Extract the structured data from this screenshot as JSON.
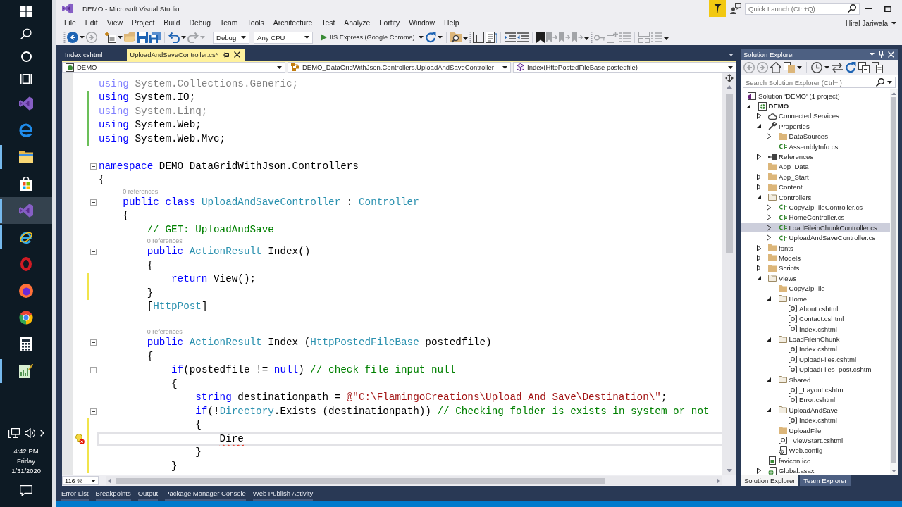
{
  "taskbar": {
    "apps": [
      {
        "running": false,
        "selected": false
      },
      {
        "running": false,
        "selected": false
      },
      {
        "running": true,
        "selected": false
      },
      {
        "running": false,
        "selected": false
      },
      {
        "running": true,
        "selected": true
      },
      {
        "running": true,
        "selected": false
      },
      {
        "running": false,
        "selected": false
      },
      {
        "running": false,
        "selected": false
      },
      {
        "running": false,
        "selected": false
      },
      {
        "running": false,
        "selected": false
      },
      {
        "running": true,
        "selected": false
      }
    ],
    "clock": {
      "time": "4:42 PM",
      "day": "Friday",
      "date": "1/31/2020"
    }
  },
  "window": {
    "title": "DEMO - Microsoft Visual Studio",
    "quick_launch": {
      "placeholder": "Quick Launch (Ctrl+Q)"
    },
    "account": "Hiral Jariwala"
  },
  "menu": [
    "File",
    "Edit",
    "View",
    "Project",
    "Build",
    "Debug",
    "Team",
    "Tools",
    "Architecture",
    "Test",
    "Analyze",
    "Fortify",
    "Window",
    "Help"
  ],
  "toolbar": {
    "left_buttons": [
      {
        "disabled": false
      },
      {
        "disabled": true
      },
      {
        "disabled": false
      },
      {
        "disabled": false
      },
      {
        "disabled": false
      },
      {
        "disabled": false
      },
      {
        "disabled": false
      },
      {
        "disabled": true
      }
    ],
    "configuration": "Debug",
    "platform": "Any CPU",
    "run_target": "IIS Express (Google Chrome)",
    "right_buttons": [
      {
        "disabled": false
      },
      {
        "disabled": false
      },
      {
        "disabled": false
      },
      {
        "disabled": false
      },
      {
        "disabled": false
      },
      {
        "disabled": false
      },
      {
        "disabled": false
      },
      {
        "disabled": true
      },
      {
        "disabled": true
      },
      {
        "disabled": true
      },
      {
        "disabled": true
      },
      {
        "disabled": true
      },
      {
        "disabled": true
      },
      {
        "disabled": true
      },
      {
        "disabled": true
      }
    ]
  },
  "document_tabs": [
    {
      "label": "Index.cshtml",
      "selected": false
    },
    {
      "label": "UploadAndSaveController.cs*",
      "selected": true
    }
  ],
  "navigation_bar": {
    "project": "DEMO",
    "type": "DEMO_DataGridWithJson.Controllers.UploadAndSaveController",
    "member": "Index(HttpPostedFileBase postedfile)"
  },
  "editor": {
    "lines": [
      {
        "faded": true,
        "current": false,
        "fold": false,
        "modified": false,
        "tokens": [
          {
            "text": "using",
            "kind": "keyword"
          },
          {
            "text": " System.Collections.Generic;",
            "kind": "plain"
          }
        ]
      },
      {
        "faded": false,
        "current": false,
        "fold": false,
        "modified": true,
        "saved": true,
        "tokens": [
          {
            "text": "using",
            "kind": "keyword"
          },
          {
            "text": " System.IO;",
            "kind": "plain"
          }
        ]
      },
      {
        "faded": true,
        "current": false,
        "fold": false,
        "modified": true,
        "saved": true,
        "tokens": [
          {
            "text": "using",
            "kind": "keyword"
          },
          {
            "text": " System.Linq;",
            "kind": "plain"
          }
        ]
      },
      {
        "faded": false,
        "current": false,
        "fold": false,
        "modified": true,
        "saved": true,
        "tokens": [
          {
            "text": "using",
            "kind": "keyword"
          },
          {
            "text": " System.Web;",
            "kind": "plain"
          }
        ]
      },
      {
        "faded": false,
        "current": false,
        "fold": false,
        "modified": true,
        "saved": true,
        "tokens": [
          {
            "text": "using",
            "kind": "keyword"
          },
          {
            "text": " System.Web.Mvc;",
            "kind": "plain"
          }
        ]
      },
      {
        "current": false,
        "fold": false,
        "modified": false
      },
      {
        "faded": false,
        "current": false,
        "fold": true,
        "modified": false,
        "tokens": [
          {
            "text": "namespace",
            "kind": "keyword"
          },
          {
            "text": " DEMO_DataGridWithJson.Controllers",
            "kind": "plain"
          }
        ]
      },
      {
        "faded": false,
        "current": false,
        "fold": false,
        "modified": false,
        "tokens": [
          {
            "text": "{",
            "kind": "plain"
          }
        ]
      },
      {
        "lens": "0 references",
        "faded": false,
        "current": false,
        "fold": true,
        "modified": false,
        "tokens": [
          {
            "text": "    public class",
            "kind": "keyword"
          },
          {
            "text": " UploadAndSaveController",
            "kind": "type"
          },
          {
            "text": " : ",
            "kind": "plain"
          },
          {
            "text": "Controller",
            "kind": "type"
          }
        ]
      },
      {
        "faded": false,
        "current": false,
        "fold": false,
        "modified": false,
        "tokens": [
          {
            "text": "    {",
            "kind": "plain"
          }
        ]
      },
      {
        "faded": false,
        "current": false,
        "fold": false,
        "modified": false,
        "tokens": [
          {
            "text": "        // GET: UploadAndSave",
            "kind": "comment"
          }
        ]
      },
      {
        "lens": "0 references",
        "faded": false,
        "current": false,
        "fold": true,
        "modified": false,
        "tokens": [
          {
            "text": "        public",
            "kind": "keyword"
          },
          {
            "text": " ActionResult",
            "kind": "type"
          },
          {
            "text": " Index()",
            "kind": "plain"
          }
        ]
      },
      {
        "faded": false,
        "current": false,
        "fold": false,
        "modified": false,
        "tokens": [
          {
            "text": "        {",
            "kind": "plain"
          }
        ]
      },
      {
        "faded": false,
        "current": false,
        "fold": false,
        "modified": true,
        "saved": false,
        "tokens": [
          {
            "text": "            return",
            "kind": "keyword"
          },
          {
            "text": " View();",
            "kind": "plain"
          }
        ]
      },
      {
        "faded": false,
        "current": false,
        "fold": false,
        "modified": true,
        "saved": false,
        "tokens": [
          {
            "text": "        }",
            "kind": "plain"
          }
        ]
      },
      {
        "faded": false,
        "current": false,
        "fold": false,
        "modified": false,
        "tokens": [
          {
            "text": "        [",
            "kind": "plain"
          },
          {
            "text": "HttpPost",
            "kind": "type"
          },
          {
            "text": "]",
            "kind": "plain"
          }
        ]
      },
      {
        "current": false,
        "fold": false,
        "modified": false
      },
      {
        "lens": "0 references",
        "faded": false,
        "current": false,
        "fold": true,
        "modified": false,
        "tokens": [
          {
            "text": "        public",
            "kind": "keyword"
          },
          {
            "text": " ActionResult",
            "kind": "type"
          },
          {
            "text": " Index (",
            "kind": "plain"
          },
          {
            "text": "HttpPostedFileBase",
            "kind": "type"
          },
          {
            "text": " postedfile)",
            "kind": "plain"
          }
        ]
      },
      {
        "faded": false,
        "current": false,
        "fold": false,
        "modified": false,
        "tokens": [
          {
            "text": "        {",
            "kind": "plain"
          }
        ]
      },
      {
        "faded": false,
        "current": false,
        "fold": true,
        "modified": false,
        "tokens": [
          {
            "text": "            if",
            "kind": "keyword"
          },
          {
            "text": "(postedfile != ",
            "kind": "plain"
          },
          {
            "text": "null",
            "kind": "keyword"
          },
          {
            "text": ") ",
            "kind": "plain"
          },
          {
            "text": "// check file input null",
            "kind": "comment"
          }
        ]
      },
      {
        "faded": false,
        "current": false,
        "fold": false,
        "modified": false,
        "tokens": [
          {
            "text": "            {",
            "kind": "plain"
          }
        ]
      },
      {
        "faded": false,
        "current": false,
        "fold": false,
        "modified": false,
        "tokens": [
          {
            "text": "                string",
            "kind": "keyword"
          },
          {
            "text": " destinationpath = ",
            "kind": "plain"
          },
          {
            "text": "@\"C:\\FlamingoCreations\\Upload_And_Save\\Destination\\\"",
            "kind": "string"
          },
          {
            "text": ";",
            "kind": "plain"
          }
        ]
      },
      {
        "faded": false,
        "current": false,
        "fold": true,
        "modified": false,
        "tokens": [
          {
            "text": "                if",
            "kind": "keyword"
          },
          {
            "text": "(!",
            "kind": "plain"
          },
          {
            "text": "Directory",
            "kind": "type"
          },
          {
            "text": ".Exists (destinationpath)) ",
            "kind": "plain"
          },
          {
            "text": "// Checking folder is exists in system or not",
            "kind": "comment"
          }
        ]
      },
      {
        "faded": false,
        "current": false,
        "fold": false,
        "modified": true,
        "saved": false,
        "tokens": [
          {
            "text": "                {",
            "kind": "plain"
          }
        ]
      },
      {
        "faded": false,
        "current": true,
        "fold": false,
        "modified": true,
        "saved": false,
        "tokens": [
          {
            "text": "                    Dire",
            "kind": "error"
          }
        ]
      },
      {
        "faded": false,
        "current": false,
        "fold": false,
        "modified": true,
        "saved": false,
        "tokens": [
          {
            "text": "                }",
            "kind": "plain"
          }
        ]
      },
      {
        "faded": false,
        "current": false,
        "fold": false,
        "modified": true,
        "saved": false,
        "tokens": [
          {
            "text": "            }",
            "kind": "plain"
          }
        ]
      }
    ],
    "zoom": "116 %"
  },
  "solution_explorer": {
    "title": "Solution Explorer",
    "toolbar_buttons": [
      {
        "disabled": true
      },
      {
        "disabled": true
      },
      {
        "disabled": false
      },
      {
        "disabled": false
      },
      {
        "disabled": false
      },
      {
        "disabled": false
      },
      {
        "disabled": false
      },
      {
        "disabled": false
      },
      {
        "disabled": false
      }
    ],
    "search": {
      "placeholder": "Search Solution Explorer (Ctrl+;)"
    },
    "tree": [
      {
        "label": "Solution 'DEMO' (1 project)",
        "kind": "solution",
        "selected": false,
        "children": [
          {
            "label": "DEMO",
            "kind": "project",
            "selected": false,
            "expanded": true,
            "children": [
              {
                "label": "Connected Services",
                "kind": "cloud",
                "selected": false,
                "expanded": false
              },
              {
                "label": "Properties",
                "kind": "wrench",
                "selected": false,
                "expanded": true,
                "children": [
                  {
                    "label": "DataSources",
                    "kind": "folder",
                    "selected": false,
                    "expanded": false
                  },
                  {
                    "label": "AssemblyInfo.cs",
                    "kind": "cs",
                    "selected": false
                  }
                ]
              },
              {
                "label": "References",
                "kind": "references",
                "selected": false,
                "expanded": false
              },
              {
                "label": "App_Data",
                "kind": "folder",
                "selected": false
              },
              {
                "label": "App_Start",
                "kind": "folder",
                "selected": false,
                "expanded": false
              },
              {
                "label": "Content",
                "kind": "folder",
                "selected": false,
                "expanded": false
              },
              {
                "label": "Controllers",
                "kind": "folder",
                "selected": false,
                "expanded": true,
                "children": [
                  {
                    "label": "CopyZipFileController.cs",
                    "kind": "cs",
                    "selected": false,
                    "expanded": false
                  },
                  {
                    "label": "HomeController.cs",
                    "kind": "cs",
                    "selected": false,
                    "expanded": false
                  },
                  {
                    "label": "LoadFileinChunkController.cs",
                    "kind": "cs",
                    "selected": true,
                    "expanded": false
                  },
                  {
                    "label": "UploadAndSaveController.cs",
                    "kind": "cs",
                    "selected": false,
                    "expanded": false
                  }
                ]
              },
              {
                "label": "fonts",
                "kind": "folder",
                "selected": false,
                "expanded": false
              },
              {
                "label": "Models",
                "kind": "folder",
                "selected": false,
                "expanded": false
              },
              {
                "label": "Scripts",
                "kind": "folder",
                "selected": false,
                "expanded": false
              },
              {
                "label": "Views",
                "kind": "folder",
                "selected": false,
                "expanded": true,
                "children": [
                  {
                    "label": "CopyZipFile",
                    "kind": "folder",
                    "selected": false
                  },
                  {
                    "label": "Home",
                    "kind": "folder",
                    "selected": false,
                    "expanded": true,
                    "children": [
                      {
                        "label": "About.cshtml",
                        "kind": "razor",
                        "selected": false
                      },
                      {
                        "label": "Contact.cshtml",
                        "kind": "razor",
                        "selected": false
                      },
                      {
                        "label": "Index.cshtml",
                        "kind": "razor",
                        "selected": false
                      }
                    ]
                  },
                  {
                    "label": "LoadFileinChunk",
                    "kind": "folder",
                    "selected": false,
                    "expanded": true,
                    "children": [
                      {
                        "label": "Index.cshtml",
                        "kind": "razor",
                        "selected": false
                      },
                      {
                        "label": "UploadFiles.cshtml",
                        "kind": "razor",
                        "selected": false
                      },
                      {
                        "label": "UploadFiles_post.cshtml",
                        "kind": "razor",
                        "selected": false
                      }
                    ]
                  },
                  {
                    "label": "Shared",
                    "kind": "folder",
                    "selected": false,
                    "expanded": true,
                    "children": [
                      {
                        "label": "_Layout.cshtml",
                        "kind": "razor",
                        "selected": false
                      },
                      {
                        "label": "Error.cshtml",
                        "kind": "razor",
                        "selected": false
                      }
                    ]
                  },
                  {
                    "label": "UploadAndSave",
                    "kind": "folder",
                    "selected": false,
                    "expanded": true,
                    "children": [
                      {
                        "label": "Index.cshtml",
                        "kind": "razor",
                        "selected": false
                      }
                    ]
                  },
                  {
                    "label": "UploadFile",
                    "kind": "folder",
                    "selected": false
                  },
                  {
                    "label": "_ViewStart.cshtml",
                    "kind": "razor",
                    "selected": false
                  },
                  {
                    "label": "Web.config",
                    "kind": "config",
                    "selected": false
                  }
                ]
              },
              {
                "label": "favicon.ico",
                "kind": "image",
                "selected": false
              },
              {
                "label": "Global.asax",
                "kind": "asax",
                "selected": false,
                "expanded": false
              }
            ]
          }
        ]
      }
    ],
    "tabs": [
      {
        "label": "Solution Explorer",
        "selected": true
      },
      {
        "label": "Team Explorer",
        "selected": false
      }
    ]
  },
  "tool_tabs": [
    "Error List",
    "Breakpoints",
    "Output",
    "Package Manager Console",
    "Web Publish Activity"
  ]
}
